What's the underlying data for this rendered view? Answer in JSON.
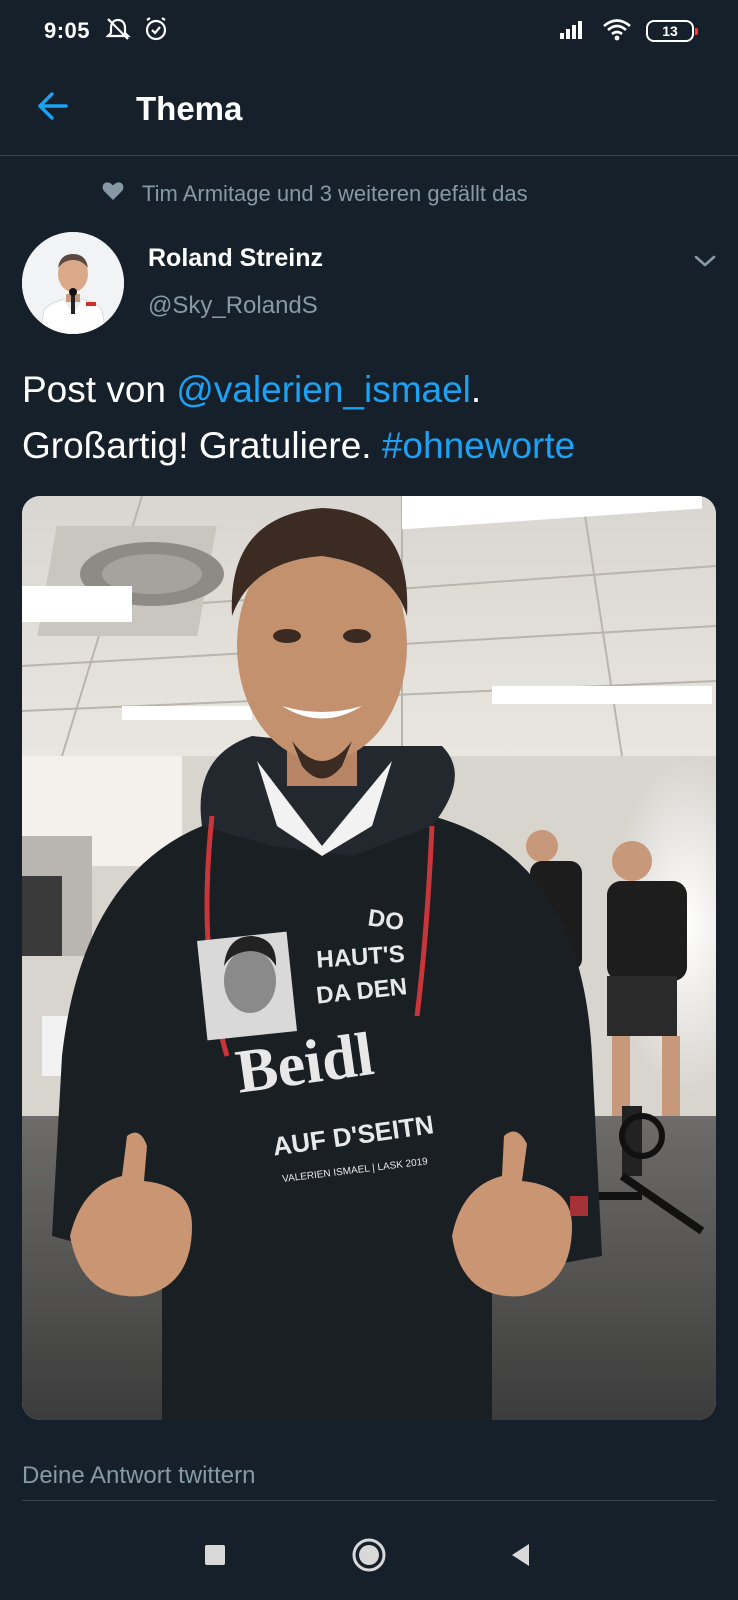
{
  "status_bar": {
    "time": "9:05",
    "battery_level": "13",
    "icons": [
      "alarm-off-icon",
      "alarm-icon",
      "signal-icon",
      "wifi-icon",
      "battery-icon"
    ]
  },
  "header": {
    "title": "Thema",
    "back_icon": "arrow-left-icon"
  },
  "social_context": {
    "text": "Tim Armitage und 3 weiteren gefällt das",
    "icon": "heart-icon"
  },
  "tweet": {
    "author_name": "Roland Streinz",
    "author_handle": "@Sky_RolandS",
    "text_part1": "Post von ",
    "mention": "@valerien_ismael",
    "text_part2": ".",
    "text_part3": "Großartig! Gratuliere. ",
    "hashtag": "#ohneworte",
    "photo": {
      "shirt_lines": [
        "DO",
        "HAUT'S",
        "DA DEN",
        "Beidl",
        "AUF D'SEITN",
        "VALERIEN ISMAEL | LASK 2019"
      ]
    }
  },
  "reply": {
    "placeholder": "Deine Antwort twittern"
  },
  "navigation": {
    "buttons": [
      "recents-square-icon",
      "home-circle-icon",
      "back-triangle-icon"
    ]
  },
  "colors": {
    "background": "#15202b",
    "accent": "#1da1f2",
    "secondary_text": "#8899a6",
    "divider": "#38444d"
  }
}
